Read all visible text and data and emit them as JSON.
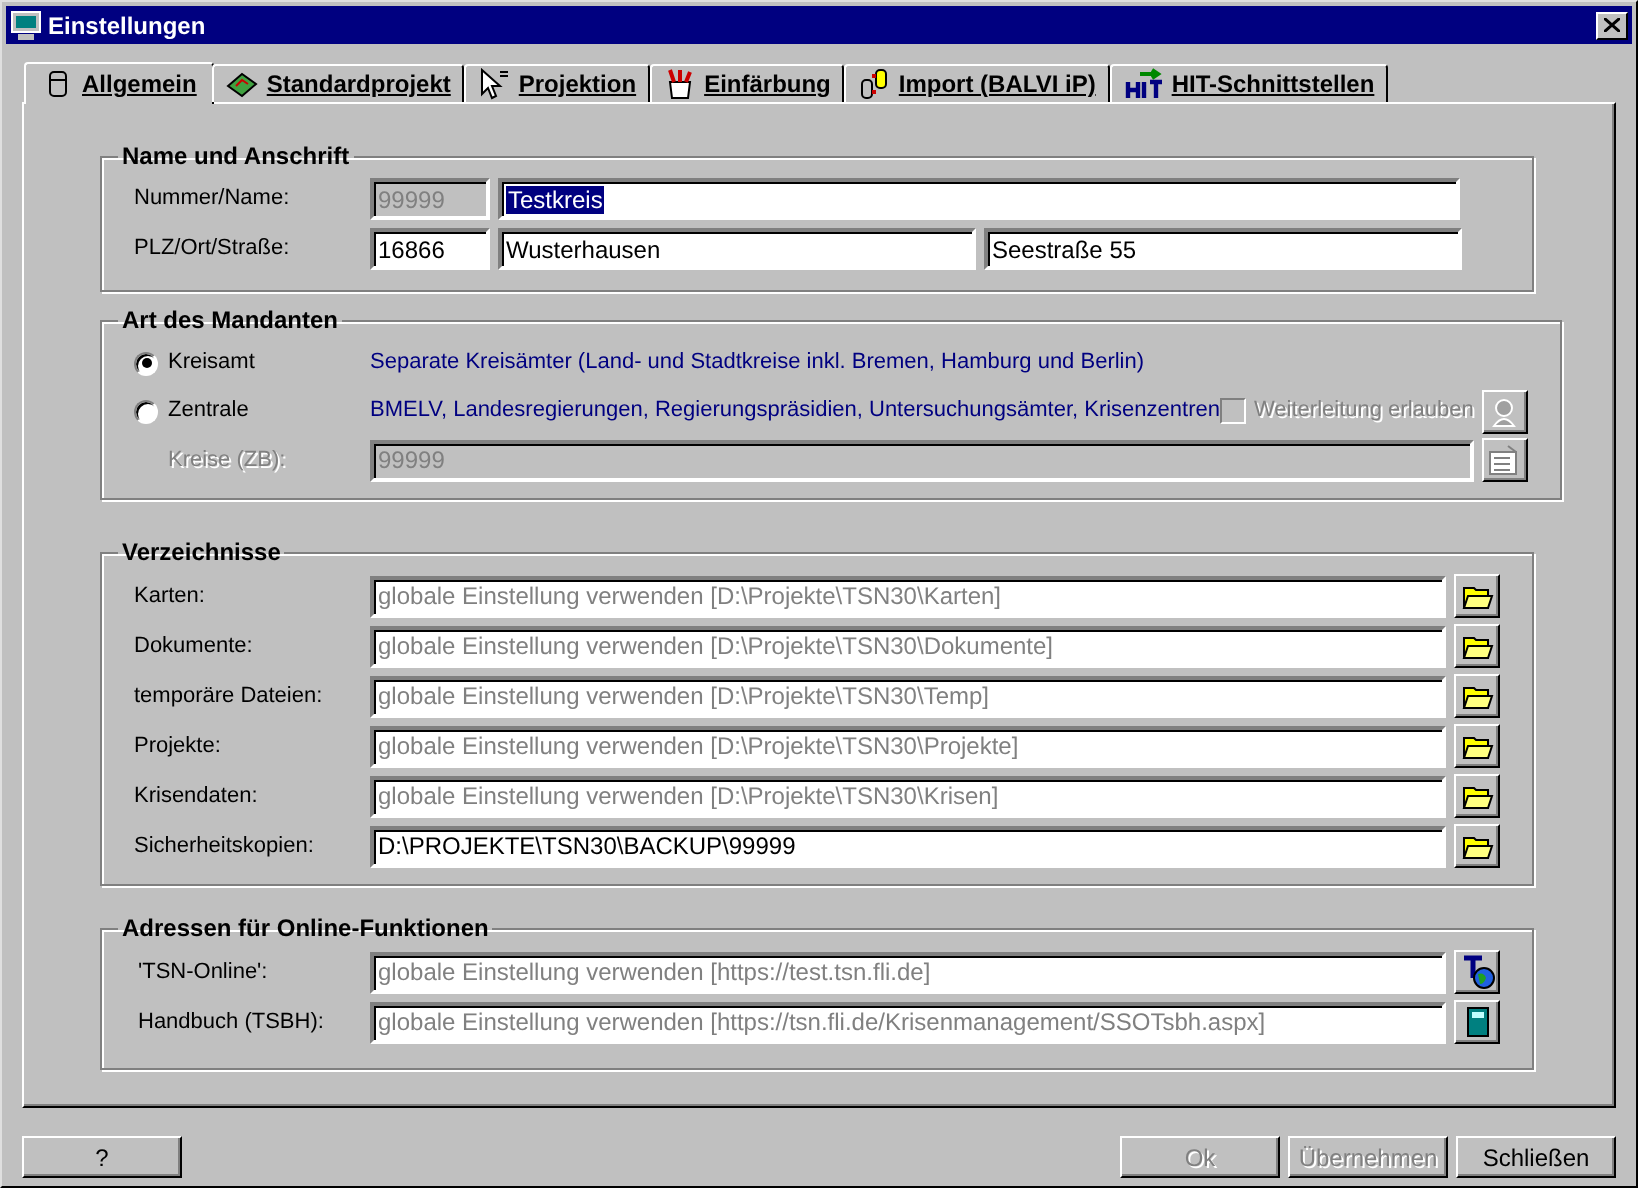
{
  "window": {
    "title": "Einstellungen"
  },
  "tabs": [
    {
      "label": "Allgemein",
      "selected": true
    },
    {
      "label": "Standardprojekt",
      "selected": false
    },
    {
      "label": "Projektion",
      "selected": false
    },
    {
      "label": "Einfärbung",
      "selected": false
    },
    {
      "label": "Import (BALVI iP)",
      "selected": false
    },
    {
      "label": "HIT-Schnittstellen",
      "selected": false
    }
  ],
  "name_group": {
    "title": "Name und Anschrift",
    "rows": [
      {
        "label": "Nummer/Name:",
        "fields": [
          {
            "value": "99999",
            "disabled": true,
            "highlighted": false
          },
          {
            "value": "Testkreis",
            "disabled": false,
            "highlighted": true
          }
        ]
      },
      {
        "label": "PLZ/Ort/Straße:",
        "fields": [
          {
            "value": "16866",
            "disabled": false,
            "highlighted": false
          },
          {
            "value": "Wusterhausen",
            "disabled": false,
            "highlighted": false
          },
          {
            "value": "Seestraße 55",
            "disabled": false,
            "highlighted": false
          }
        ]
      }
    ]
  },
  "mandant_group": {
    "title": "Art des Mandanten",
    "options": [
      {
        "label": "Kreisamt",
        "selected": true,
        "description": "Separate Kreisämter (Land- und Stadtkreise inkl. Bremen, Hamburg und Berlin)"
      },
      {
        "label": "Zentrale",
        "selected": false,
        "description": "BMELV, Landesregierungen, Regierungspräsidien, Untersuchungsämter, Krisenzentren"
      }
    ],
    "forwarding": {
      "label": "Weiterleitung erlauben",
      "checked": false,
      "disabled": true
    },
    "kreise": {
      "label": "Kreise (ZB):",
      "value": "99999",
      "disabled": true
    }
  },
  "directories": {
    "title": "Verzeichnisse",
    "rows": [
      {
        "label": "Karten:",
        "placeholder": "globale Einstellung verwenden [D:\\Projekte\\TSN30\\Karten]"
      },
      {
        "label": "Dokumente:",
        "placeholder": "globale Einstellung verwenden [D:\\Projekte\\TSN30\\Dokumente]"
      },
      {
        "label": "temporäre Dateien:",
        "placeholder": "globale Einstellung verwenden [D:\\Projekte\\TSN30\\Temp]"
      },
      {
        "label": "Projekte:",
        "placeholder": "globale Einstellung verwenden [D:\\Projekte\\TSN30\\Projekte]"
      },
      {
        "label": "Krisendaten:",
        "placeholder": "globale Einstellung verwenden [D:\\Projekte\\TSN30\\Krisen]"
      },
      {
        "label": "Sicherheitskopien:",
        "value": "D:\\PROJEKTE\\TSN30\\BACKUP\\99999"
      }
    ]
  },
  "online": {
    "title": "Adressen für Online-Funktionen",
    "rows": [
      {
        "label": "'TSN-Online':",
        "placeholder": "globale Einstellung verwenden [https://test.tsn.fli.de]"
      },
      {
        "label": "Handbuch (TSBH):",
        "placeholder": "globale Einstellung verwenden [https://tsn.fli.de/Krisenmanagement/SSOTsbh.aspx]"
      }
    ]
  },
  "buttons": [
    {
      "label": "?",
      "disabled": false
    },
    {
      "label": "Ok",
      "disabled": true
    },
    {
      "label": "Übernehmen",
      "disabled": true
    },
    {
      "label": "Schließen",
      "disabled": false
    }
  ]
}
